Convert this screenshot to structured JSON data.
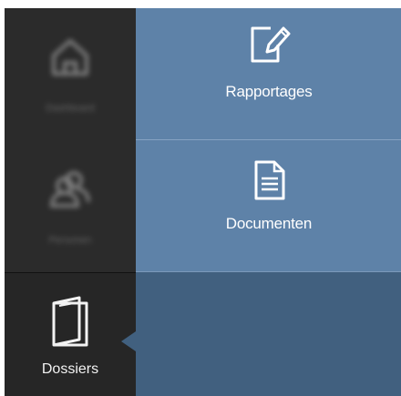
{
  "sidebar": {
    "items": [
      {
        "label": "Dashboard",
        "icon": "home-icon"
      },
      {
        "label": "Personen",
        "icon": "people-icon"
      },
      {
        "label": "Dossiers",
        "icon": "folder-book-icon",
        "active": true
      }
    ]
  },
  "panel": {
    "tiles": [
      {
        "label": "Rapportages",
        "icon": "edit-document-icon"
      },
      {
        "label": "Documenten",
        "icon": "document-icon"
      }
    ]
  },
  "colors": {
    "sidebar_bg": "#2b2b2b",
    "tile_bg": "#5e82a8",
    "panel_bg": "#41607f"
  }
}
